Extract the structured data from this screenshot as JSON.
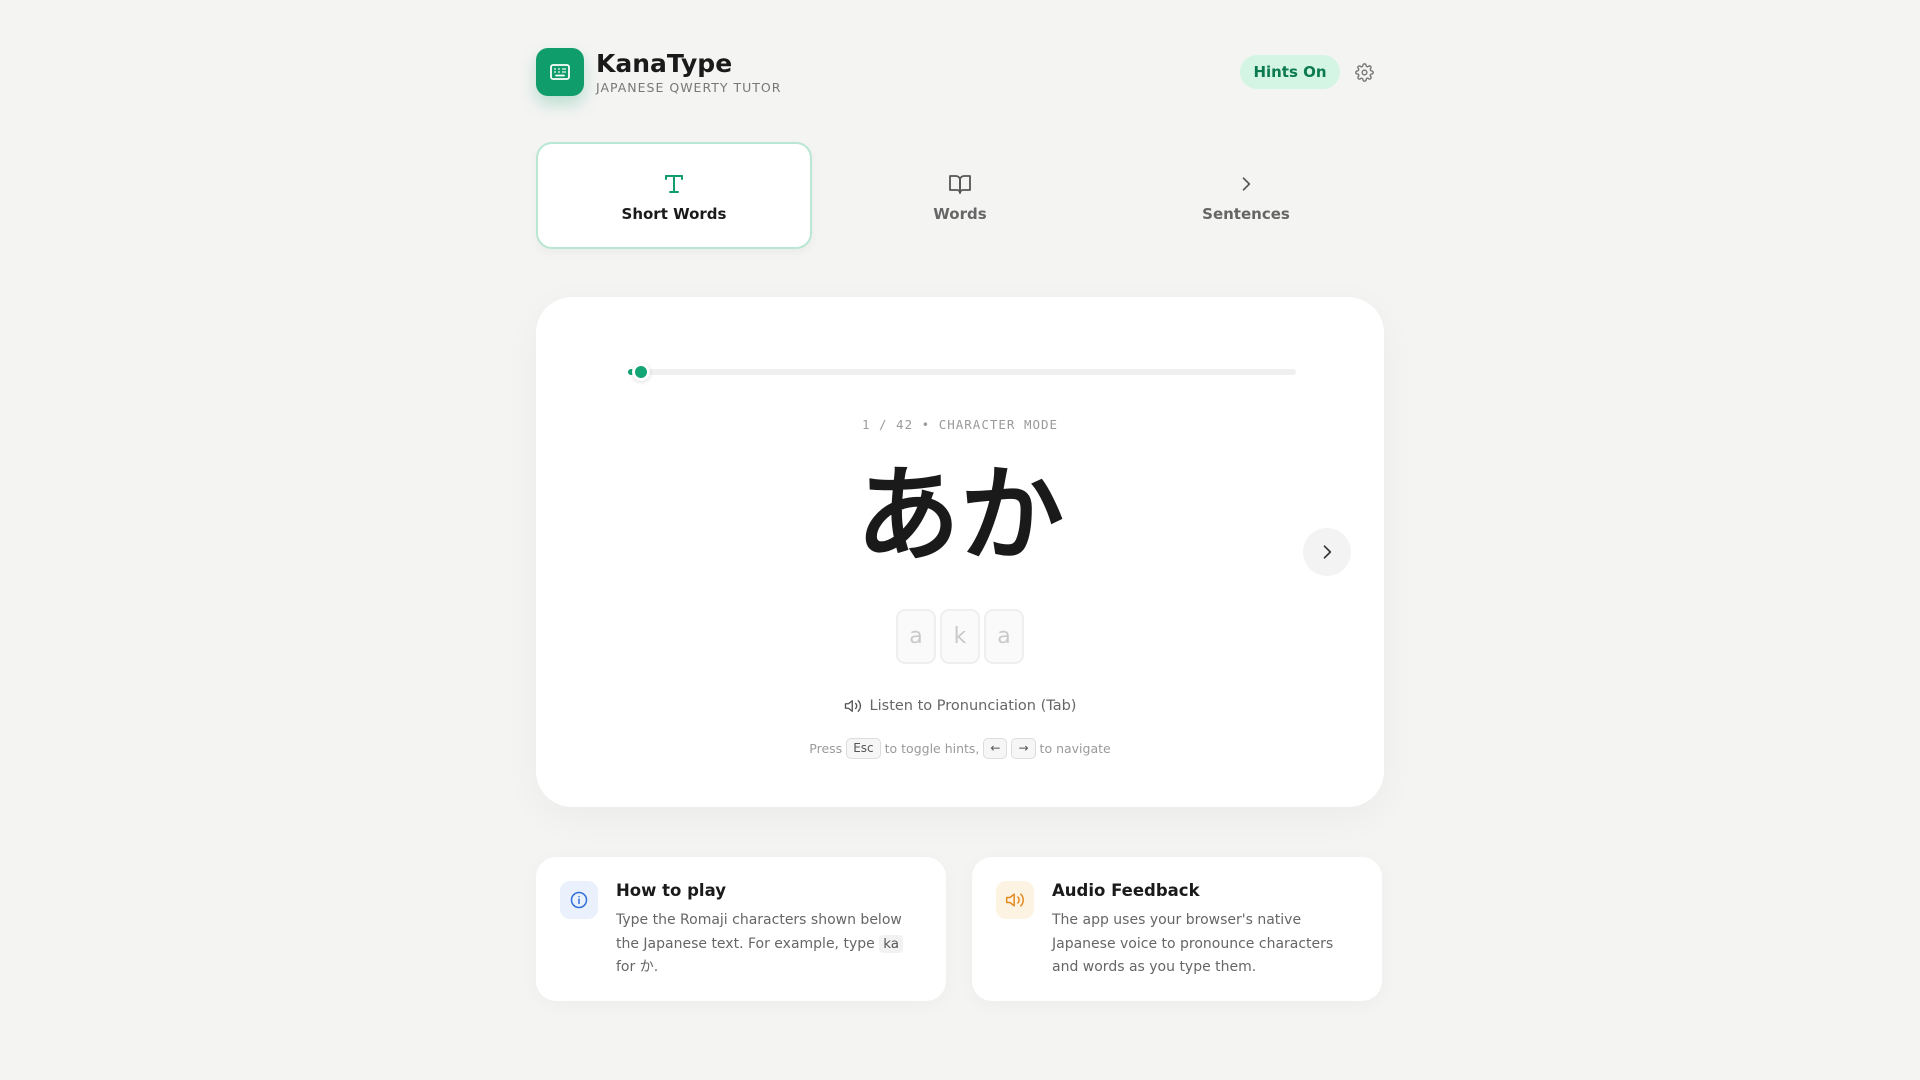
{
  "app": {
    "name": "KanaType",
    "subtitle": "JAPANESE QWERTY TUTOR",
    "hints_label": "Hints On",
    "brand_color": "#0f9d6b"
  },
  "tabs": [
    {
      "label": "Short Words",
      "icon": "type-icon",
      "active": true
    },
    {
      "label": "Words",
      "icon": "book-icon",
      "active": false
    },
    {
      "label": "Sentences",
      "icon": "chevron-right-icon",
      "active": false
    }
  ],
  "practice": {
    "progress": 0.02,
    "counter": "1 / 42",
    "mode": "CHARACTER MODE",
    "kana": "あか",
    "romaji": [
      "a",
      "k",
      "a"
    ],
    "listen_label": "Listen to Pronunciation (Tab)",
    "shortcut": {
      "press": "Press",
      "esc_key": "Esc",
      "toggle_text": "to toggle hints,",
      "left_key": "←",
      "right_key": "→",
      "navigate_text": "to navigate"
    }
  },
  "info_cards": {
    "how_to_play": {
      "title": "How to play",
      "body_1": "Type the Romaji characters shown below the Japanese text. For example, type ",
      "code": "ka",
      "body_2": " for か.",
      "icon": "info-icon"
    },
    "audio_feedback": {
      "title": "Audio Feedback",
      "body": "The app uses your browser's native Japanese voice to pronounce characters and words as you type them.",
      "icon": "speaker-icon"
    }
  }
}
